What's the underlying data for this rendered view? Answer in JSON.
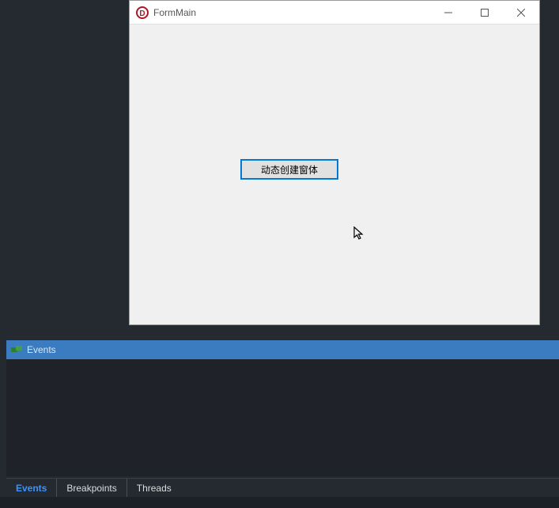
{
  "window": {
    "title": "FormMain",
    "button_label": "动态创建窗体"
  },
  "panel": {
    "title": "Events"
  },
  "tabs": {
    "events": "Events",
    "breakpoints": "Breakpoints",
    "threads": "Threads"
  }
}
